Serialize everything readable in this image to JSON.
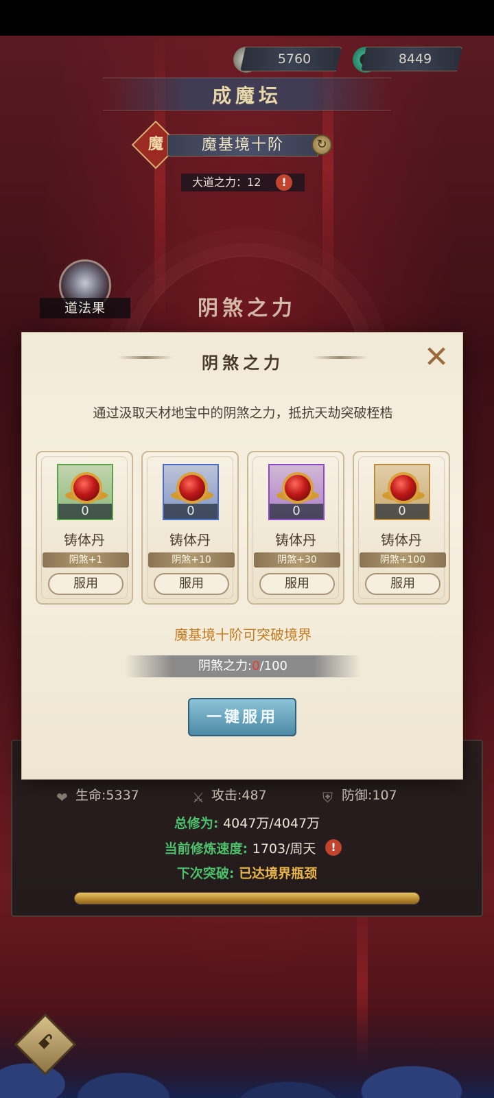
{
  "currency": {
    "silver": "5760",
    "jade": "8449"
  },
  "header": {
    "title": "成魔坛",
    "realm_badge": "魔",
    "realm": "魔基境十阶",
    "dao_power_label": "大道之力：",
    "dao_power_value": "12"
  },
  "side": {
    "daofa_label": "道法果",
    "bg_title": "阴煞之力"
  },
  "dialog": {
    "title": "阴煞之力",
    "description": "通过汲取天材地宝中的阴煞之力，抵抗天劫突破桎梏",
    "items": [
      {
        "count": "0",
        "name": "铸体丹",
        "bonus": "阴煞+1",
        "use": "服用",
        "frame_color": "#5aa04a"
      },
      {
        "count": "0",
        "name": "铸体丹",
        "bonus": "阴煞+10",
        "use": "服用",
        "frame_color": "#4a6cc0"
      },
      {
        "count": "0",
        "name": "铸体丹",
        "bonus": "阴煞+30",
        "use": "服用",
        "frame_color": "#8a4ac0"
      },
      {
        "count": "0",
        "name": "铸体丹",
        "bonus": "阴煞+100",
        "use": "服用",
        "frame_color": "#b88a3a"
      }
    ],
    "note": "魔基境十阶可突破境界",
    "yin_label": "阴煞之力:",
    "yin_current": "0",
    "yin_max": "/100",
    "one_click": "一键服用"
  },
  "stats": {
    "hp_label": "生命:",
    "hp_value": "5337",
    "atk_label": "攻击:",
    "atk_value": "487",
    "def_label": "防御:",
    "def_value": "107"
  },
  "cultivation": {
    "total_label": "总修为:",
    "total_value": "4047万/4047万",
    "speed_label": "当前修炼速度:",
    "speed_value": "1703/周天",
    "next_label": "下次突破:",
    "next_value": "已达境界瓶颈",
    "progress_fraction": 1.0
  }
}
